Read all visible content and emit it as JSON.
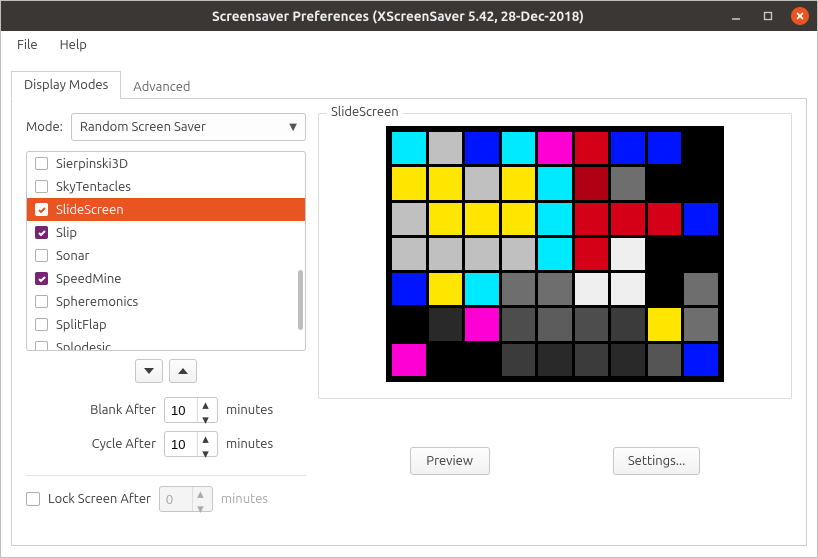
{
  "window": {
    "title": "Screensaver Preferences  (XScreenSaver 5.42, 28-Dec-2018)"
  },
  "menubar": {
    "file": "File",
    "help": "Help"
  },
  "tabs": {
    "display_modes": "Display Modes",
    "advanced": "Advanced"
  },
  "mode": {
    "label": "Mode:",
    "value": "Random Screen Saver"
  },
  "list": {
    "items": [
      {
        "label": "Sierpinski3D",
        "checked": false,
        "selected": false
      },
      {
        "label": "SkyTentacles",
        "checked": false,
        "selected": false
      },
      {
        "label": "SlideScreen",
        "checked": true,
        "selected": true
      },
      {
        "label": "Slip",
        "checked": true,
        "selected": false
      },
      {
        "label": "Sonar",
        "checked": false,
        "selected": false
      },
      {
        "label": "SpeedMine",
        "checked": true,
        "selected": false
      },
      {
        "label": "Spheremonics",
        "checked": false,
        "selected": false
      },
      {
        "label": "SplitFlap",
        "checked": false,
        "selected": false
      },
      {
        "label": "Splodesic",
        "checked": false,
        "selected": false
      }
    ]
  },
  "timing": {
    "blank_label": "Blank After",
    "blank_value": "10",
    "blank_units": "minutes",
    "cycle_label": "Cycle After",
    "cycle_value": "10",
    "cycle_units": "minutes"
  },
  "lock": {
    "label": "Lock Screen After",
    "value": "0",
    "units": "minutes"
  },
  "preview": {
    "title": "SlideScreen",
    "preview_btn": "Preview",
    "settings_btn": "Settings...",
    "tiles": [
      "#00eaff",
      "#c0c0c0",
      "#0015ff",
      "#00eaff",
      "#ff00d4",
      "#d40018",
      "#0015ff",
      "#0015ff",
      "#000000",
      "#ffe600",
      "#ffe600",
      "#c0c0c0",
      "#ffe600",
      "#00eaff",
      "#b00014",
      "#6e6e6e",
      "#000000",
      "#000000",
      "#c0c0c0",
      "#ffe600",
      "#ffe600",
      "#ffe600",
      "#00eaff",
      "#d40018",
      "#d40018",
      "#d40018",
      "#0015ff",
      "#c0c0c0",
      "#c0c0c0",
      "#c0c0c0",
      "#c0c0c0",
      "#00eaff",
      "#d40018",
      "#efefef",
      "#000000",
      "#000000",
      "#0015ff",
      "#ffe600",
      "#00eaff",
      "#6e6e6e",
      "#6e6e6e",
      "#efefef",
      "#efefef",
      "#000000",
      "#6e6e6e",
      "#000000",
      "#292929",
      "#ff00d4",
      "#4d4d4d",
      "#5c5c5c",
      "#4d4d4d",
      "#3b3b3b",
      "#ffe600",
      "#6e6e6e",
      "#ff00d4",
      "#000000",
      "#000000",
      "#3b3b3b",
      "#292929",
      "#3b3b3b",
      "#292929",
      "#555555",
      "#0015ff"
    ]
  }
}
